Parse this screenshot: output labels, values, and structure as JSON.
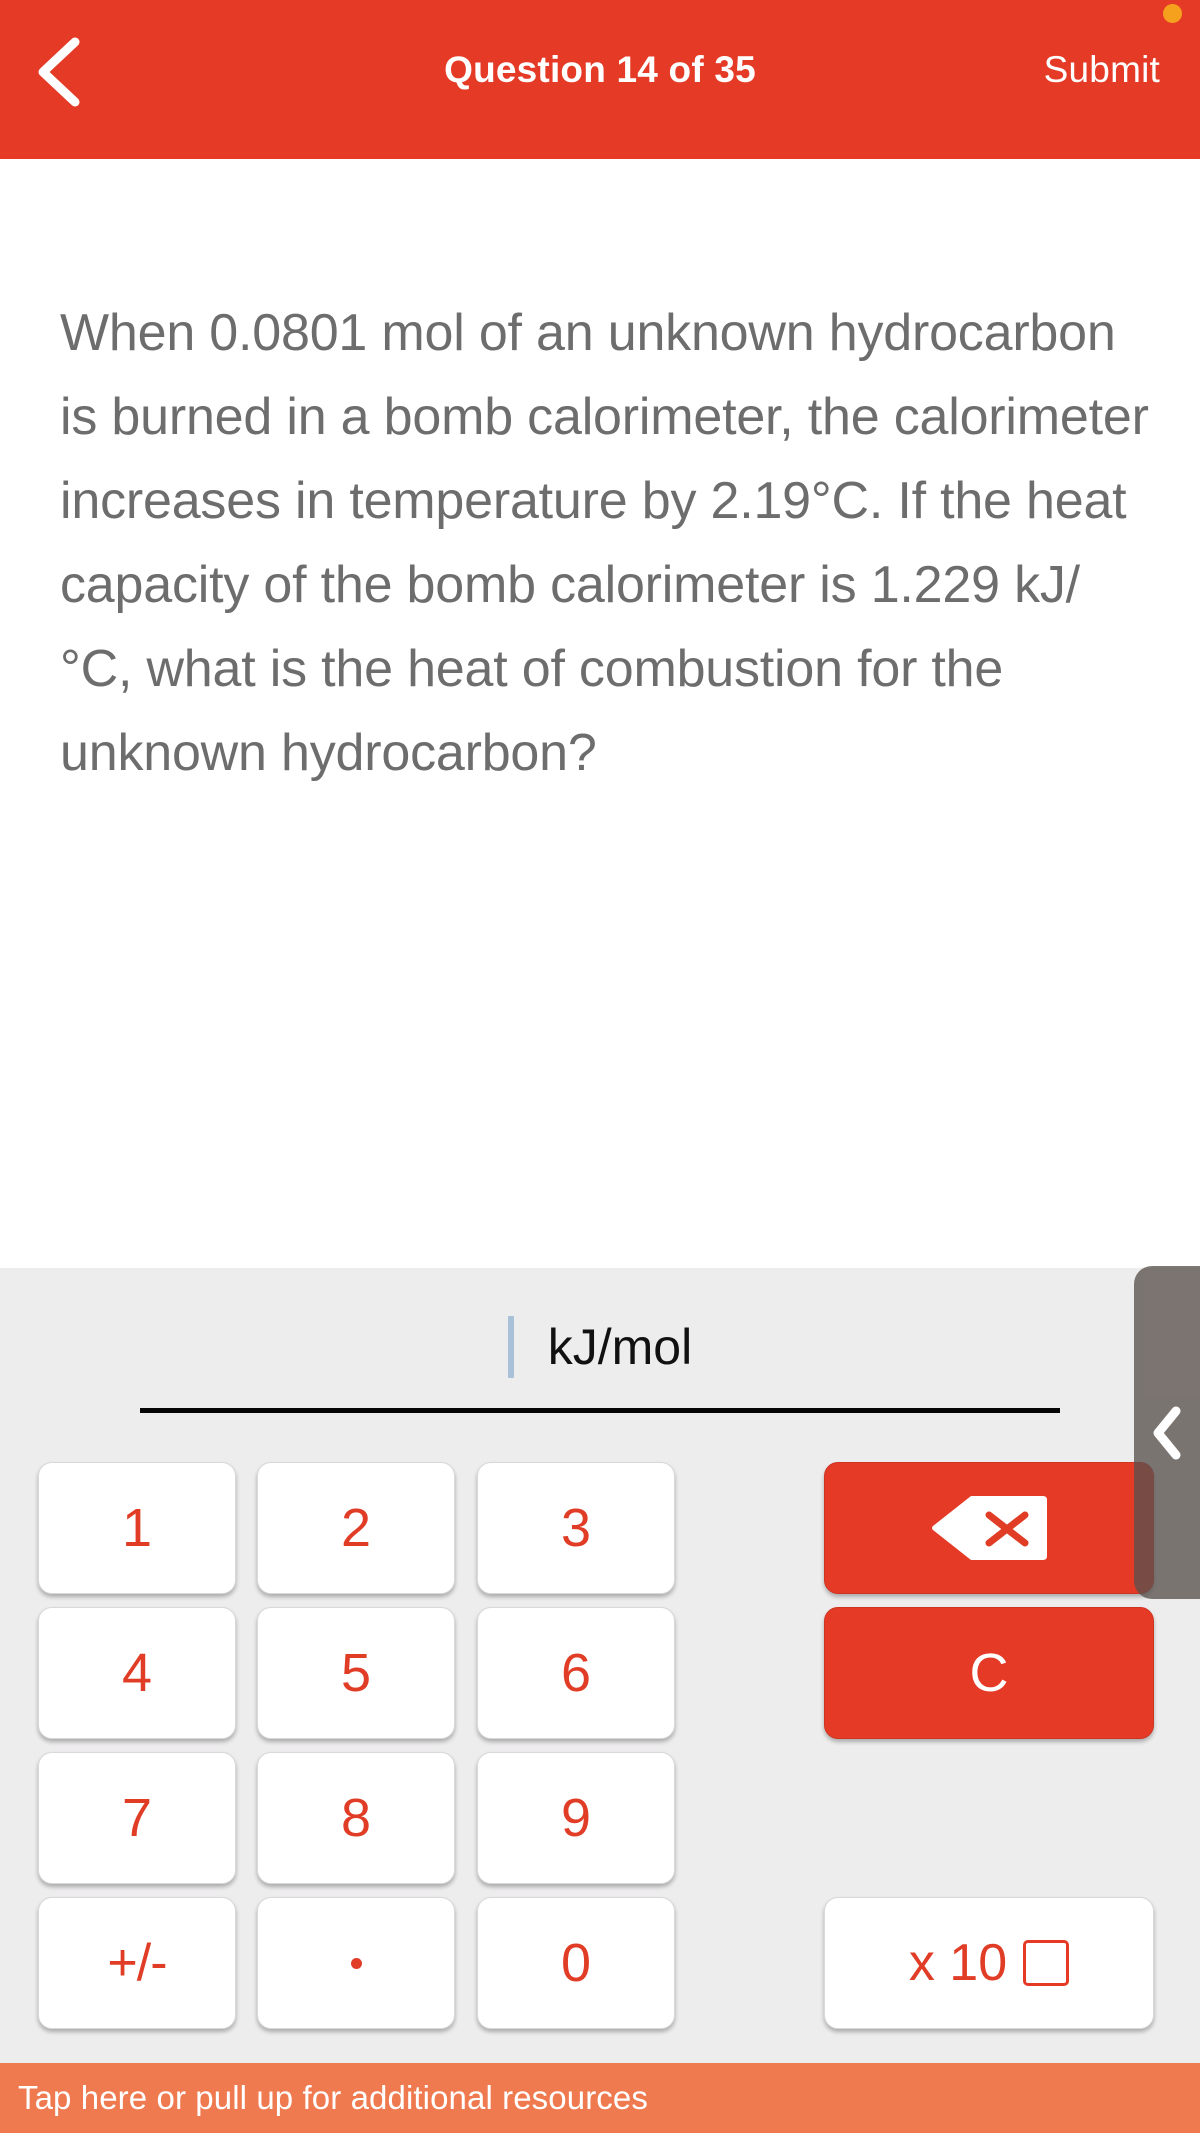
{
  "header": {
    "back_icon": "chevron-left-icon",
    "title": "Question 14 of 35",
    "submit_label": "Submit",
    "notification_dot_color": "#f5a11e",
    "background_color": "#e53a26"
  },
  "question": {
    "text": "When 0.0801 mol of an unknown hydrocarbon is burned in a bomb calorimeter, the calorimeter increases in temperature by 2.19°C. If the heat capacity of the bomb calorimeter is 1.229 kJ/°C, what is the heat of combustion for the unknown hydrocarbon?"
  },
  "answer": {
    "value": "",
    "units": "kJ/mol",
    "caret_color": "#a8c0d8"
  },
  "keypad": {
    "accent_color": "#e03c26",
    "panel_color": "#eeedee",
    "keys": [
      {
        "name": "key-1",
        "label": "1",
        "style": "num"
      },
      {
        "name": "key-2",
        "label": "2",
        "style": "num"
      },
      {
        "name": "key-3",
        "label": "3",
        "style": "num"
      },
      {
        "name": "key-4",
        "label": "4",
        "style": "num"
      },
      {
        "name": "key-5",
        "label": "5",
        "style": "num"
      },
      {
        "name": "key-6",
        "label": "6",
        "style": "num"
      },
      {
        "name": "key-7",
        "label": "7",
        "style": "num"
      },
      {
        "name": "key-8",
        "label": "8",
        "style": "num"
      },
      {
        "name": "key-9",
        "label": "9",
        "style": "num"
      },
      {
        "name": "key-plus-minus",
        "label": "+/-",
        "style": "num"
      },
      {
        "name": "key-decimal",
        "label": ".",
        "style": "num"
      },
      {
        "name": "key-0",
        "label": "0",
        "style": "num"
      }
    ],
    "backspace": {
      "name": "backspace-key",
      "icon": "backspace-icon"
    },
    "clear": {
      "name": "clear-key",
      "label": "C"
    },
    "exponent": {
      "name": "exponent-key",
      "label": "x 10",
      "exponent_placeholder": "empty-box"
    }
  },
  "side_tab": {
    "icon": "chevron-left-icon"
  },
  "bottom_banner": {
    "text": "Tap here or pull up for additional resources",
    "background_color": "#f07a50"
  }
}
